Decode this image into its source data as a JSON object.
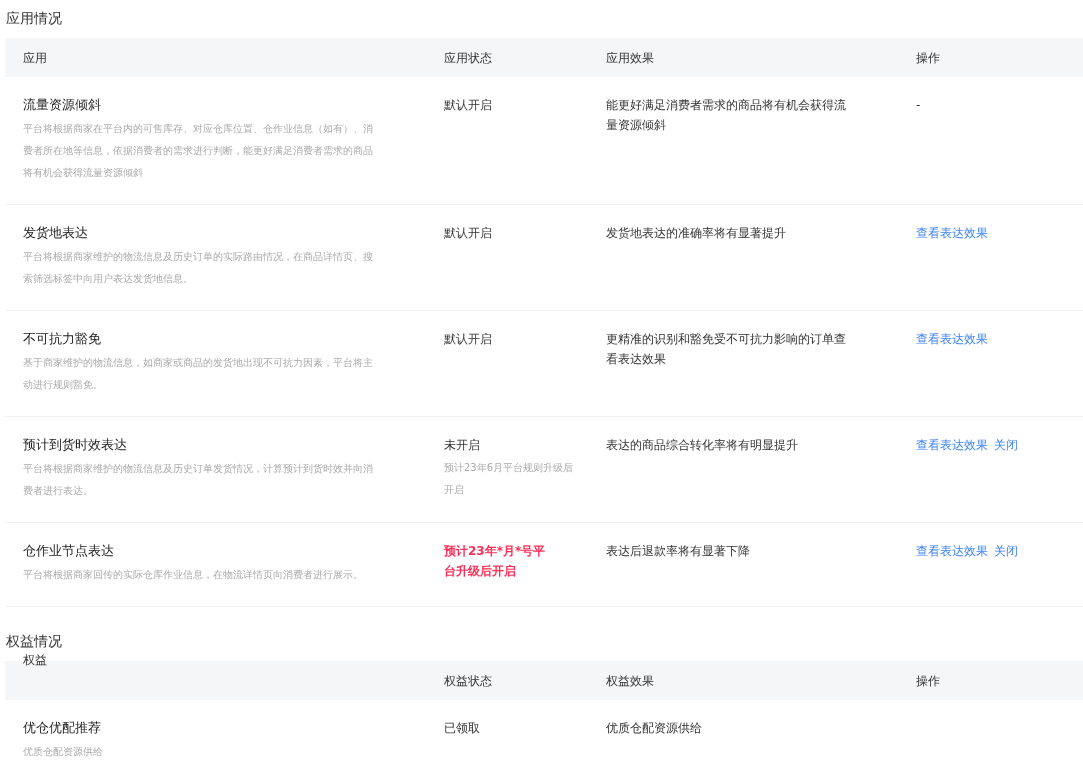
{
  "sections": [
    {
      "title": "应用情况",
      "columns": [
        "应用",
        "应用状态",
        "应用效果",
        "操作"
      ],
      "rows": [
        {
          "name": "流量资源倾斜",
          "description": "平台将根据商家在平台内的可售库存、对应仓库位置、仓作业信息（如有）、消费者所在地等信息，依据消费者的需求进行判断，能更好满足消费者需求的商品将有机会获得流量资源倾斜",
          "status": {
            "kind": "on",
            "text": "默认开启"
          },
          "effect": "能更好满足消费者需求的商品将有机会获得流量资源倾斜",
          "actions": [],
          "placeholder": "-"
        },
        {
          "name": "发货地表达",
          "description": "平台将根据商家维护的物流信息及历史订单的实际路由情况，在商品详情页、搜索筛选标签中向用户表达发货地信息。",
          "status": {
            "kind": "on",
            "text": "默认开启"
          },
          "effect": "发货地表达的准确率将有显著提升",
          "actions": [
            "查看表达效果"
          ]
        },
        {
          "name": "不可抗力豁免",
          "description": "基于商家维护的物流信息，如商家或商品的发货地出现不可抗力因素，平台将主动进行规则豁免。",
          "status": {
            "kind": "on",
            "text": "默认开启"
          },
          "effect": "更精准的识别和豁免受不可抗力影响的订单查看表达效果",
          "actions": [
            "查看表达效果"
          ]
        },
        {
          "name": "预计到货时效表达",
          "description": "平台将根据商家维护的物流信息及历史订单发货情况，计算预计到货时效并向消费者进行表达。",
          "status": {
            "kind": "off",
            "text": "未开启",
            "note": "预计23年6月平台规则升级后开启"
          },
          "effect": "表达的商品综合转化率将有明显提升",
          "actions": [
            "查看表达效果",
            "关闭"
          ]
        },
        {
          "name": "仓作业节点表达",
          "description": "平台将根据商家回传的实际仓库作业信息，在物流详情页向消费者进行展示。",
          "status": {
            "kind": "warning",
            "text": "预计23年*月*号平台升级后开启"
          },
          "effect": "表达后退款率将有显著下降",
          "actions": [
            "查看表达效果",
            "关闭"
          ]
        }
      ]
    },
    {
      "title": "权益情况",
      "columns": [
        "权益",
        "权益状态",
        "权益效果",
        "操作"
      ],
      "rows": [
        {
          "name": "优仓优配推荐",
          "description": "优质仓配资源供给",
          "status": {
            "kind": "on",
            "text": "已领取"
          },
          "effect": "优质仓配资源供给",
          "actions": []
        }
      ]
    }
  ]
}
